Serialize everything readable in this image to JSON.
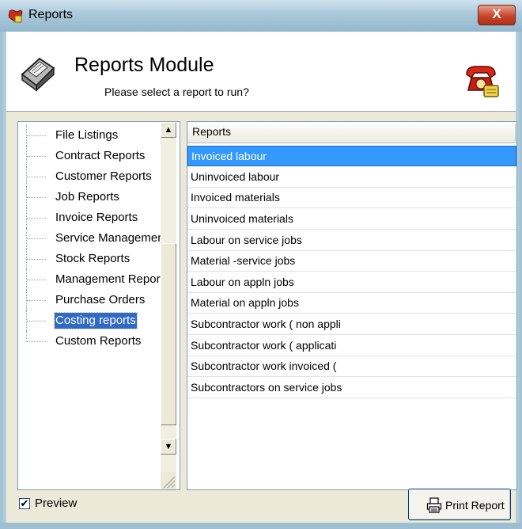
{
  "window": {
    "title": "Reports",
    "close_label": "X"
  },
  "header": {
    "title": "Reports Module",
    "subtitle": "Please select a report to run?"
  },
  "tree": {
    "items": [
      {
        "label": "File Listings"
      },
      {
        "label": "Contract Reports"
      },
      {
        "label": "Customer Reports"
      },
      {
        "label": "Job Reports"
      },
      {
        "label": "Invoice Reports"
      },
      {
        "label": "Service Management"
      },
      {
        "label": "Stock Reports"
      },
      {
        "label": "Management Reports"
      },
      {
        "label": "Purchase Orders"
      },
      {
        "label": "Costing reports",
        "selected": true
      },
      {
        "label": "Custom Reports"
      }
    ],
    "scroll_up": "▲",
    "scroll_down": "▼"
  },
  "reports": {
    "column_header": "Reports",
    "rows": [
      {
        "label": "Invoiced labour",
        "selected": true
      },
      {
        "label": "Uninvoiced labour"
      },
      {
        "label": "Invoiced materials"
      },
      {
        "label": "Uninvoiced materials"
      },
      {
        "label": "Labour on service jobs"
      },
      {
        "label": "Material -service jobs"
      },
      {
        "label": "Labour on appln jobs"
      },
      {
        "label": "Material on appln jobs"
      },
      {
        "label": "Subcontractor work ( non appli"
      },
      {
        "label": "Subcontractor work ( applicati"
      },
      {
        "label": "Subcontractor work invoiced ("
      },
      {
        "label": "Subcontractors on service jobs"
      }
    ]
  },
  "footer": {
    "preview_label": "Preview",
    "preview_checked": true,
    "print_button_label": "Print Report"
  },
  "colors": {
    "selection": "#3399ff",
    "tree_selection": "#316ac5",
    "close_button": "#c6452a"
  }
}
